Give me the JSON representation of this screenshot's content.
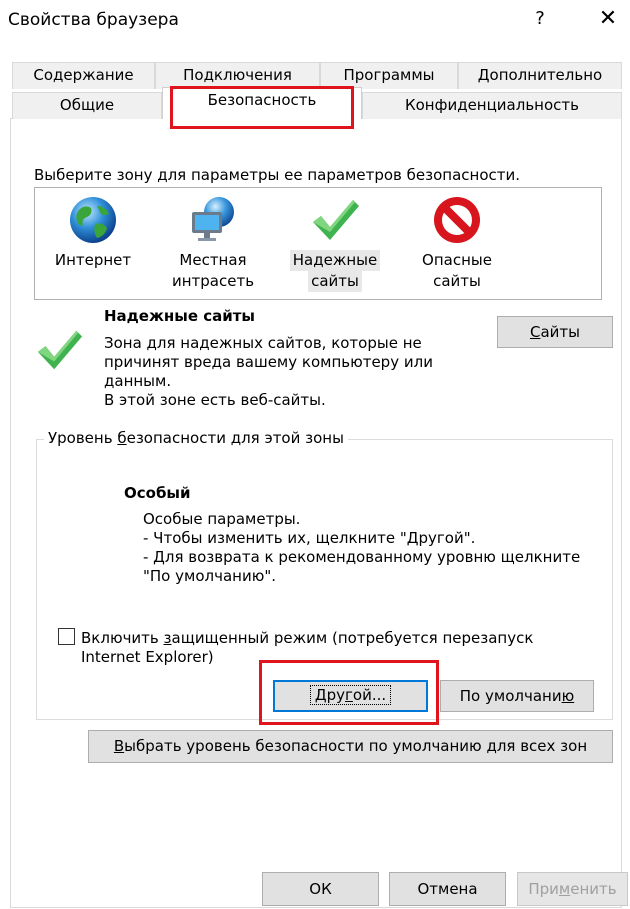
{
  "window": {
    "title": "Свойства браузера",
    "help_glyph": "?",
    "close_glyph": "✕"
  },
  "tabs": {
    "row1": [
      "Содержание",
      "Подключения",
      "Программы",
      "Дополнительно"
    ],
    "row2": [
      "Общие",
      "Безопасность",
      "Конфиденциальность"
    ],
    "active": "Безопасность"
  },
  "security": {
    "zone_prompt": "Выберите зону для параметры ее параметров безопасности.",
    "zones": [
      {
        "line1": "Интернет",
        "line2": "",
        "icon": "globe-icon"
      },
      {
        "line1": "Местная",
        "line2": "интрасеть",
        "icon": "intranet-icon"
      },
      {
        "line1": "Надежные",
        "line2": "сайты",
        "icon": "checkmark-icon"
      },
      {
        "line1": "Опасные",
        "line2": "сайты",
        "icon": "prohibited-icon"
      }
    ],
    "selected_zone_title": "Надежные сайты",
    "selected_zone_desc": [
      "Зона для надежных сайтов, которые не",
      "причинят вреда вашему компьютеру или",
      "данным.",
      "В этой зоне есть веб-сайты."
    ],
    "sites_button": {
      "pre": "",
      "ul": "С",
      "post": "айты"
    },
    "level_group": {
      "pre": "Уровень ",
      "ul": "б",
      "post": "езопасности для этой зоны"
    },
    "level_title": "Особый",
    "level_desc": [
      "Особые параметры.",
      "- Чтобы изменить их, щелкните \"Другой\".",
      "- Для возврата к рекомендованному уровню щелкните",
      "\"По умолчанию\"."
    ],
    "protected_mode": {
      "pre": "Включить ",
      "ul": "з",
      "post": "ащищенный режим (потребуется перезапуск",
      "line2": "Internet Explorer)",
      "checked": false
    },
    "custom_button": {
      "pre": "Дру",
      "ul": "г",
      "post": "ой..."
    },
    "default_button": {
      "pre": "По умолчани",
      "ul": "ю",
      "post": ""
    },
    "reset_all_button": {
      "pre": "",
      "ul": "В",
      "post": "ыбрать уровень безопасности по умолчанию для всех зон"
    }
  },
  "footer": {
    "ok": "ОК",
    "cancel": "Отмена",
    "apply": {
      "pre": "При",
      "ul": "м",
      "post": "енить",
      "enabled": false
    }
  },
  "colors": {
    "highlight_box": "#e0141c",
    "focus_border": "#0078d7",
    "button_face": "#e1e1e1"
  }
}
